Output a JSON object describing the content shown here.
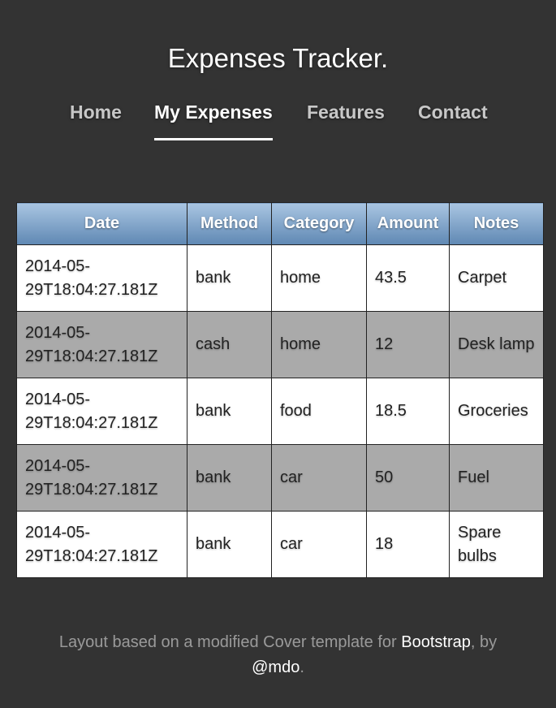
{
  "header": {
    "title": "Expenses Tracker."
  },
  "nav": {
    "items": [
      {
        "label": "Home",
        "active": false
      },
      {
        "label": "My Expenses",
        "active": true
      },
      {
        "label": "Features",
        "active": false
      },
      {
        "label": "Contact",
        "active": false
      }
    ]
  },
  "table": {
    "columns": [
      "Date",
      "Method",
      "Category",
      "Amount",
      "Notes"
    ],
    "rows": [
      {
        "date": "2014-05-29T18:04:27.181Z",
        "method": "bank",
        "category": "home",
        "amount": "43.5",
        "notes": "Carpet"
      },
      {
        "date": "2014-05-29T18:04:27.181Z",
        "method": "cash",
        "category": "home",
        "amount": "12",
        "notes": "Desk lamp"
      },
      {
        "date": "2014-05-29T18:04:27.181Z",
        "method": "bank",
        "category": "food",
        "amount": "18.5",
        "notes": "Groceries"
      },
      {
        "date": "2014-05-29T18:04:27.181Z",
        "method": "bank",
        "category": "car",
        "amount": "50",
        "notes": "Fuel"
      },
      {
        "date": "2014-05-29T18:04:27.181Z",
        "method": "bank",
        "category": "car",
        "amount": "18",
        "notes": "Spare bulbs"
      }
    ]
  },
  "footer": {
    "text_before": "Layout based on a modified Cover template for ",
    "bootstrap_link": "Bootstrap",
    "text_middle": ", by ",
    "author_link": "@mdo",
    "text_after": "."
  },
  "colors": {
    "background": "#333333",
    "header_gradient_top": "#a9c5e2",
    "header_gradient_bottom": "#5f88b3",
    "row_even": "#aaaaaa",
    "row_odd": "#ffffff"
  }
}
